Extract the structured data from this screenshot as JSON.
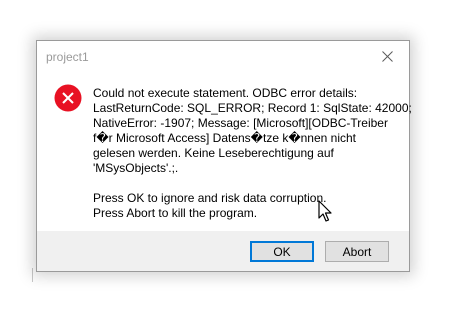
{
  "dialog": {
    "title": "project1",
    "message_lines": [
      "Could not execute statement. ODBC error details:",
      "LastReturnCode: SQL_ERROR; Record 1: SqlState: 42000;",
      "NativeError: -1907; Message: [Microsoft][ODBC-Treiber",
      "f�r Microsoft Access] Datens�tze k�nnen nicht",
      "gelesen werden. Keine Leseberechtigung auf",
      "'MSysObjects'.;."
    ],
    "instruction_lines": [
      "Press OK to ignore and risk data corruption.",
      "Press Abort to kill the program."
    ],
    "buttons": {
      "ok_label": "OK",
      "abort_label": "Abort"
    },
    "icons": {
      "status": "error-icon",
      "close": "close-icon",
      "pointer": "mouse-cursor-icon"
    },
    "colors": {
      "error_red": "#e81123",
      "focus_blue": "#0078d7",
      "footer_bg": "#f0f0f0"
    }
  }
}
